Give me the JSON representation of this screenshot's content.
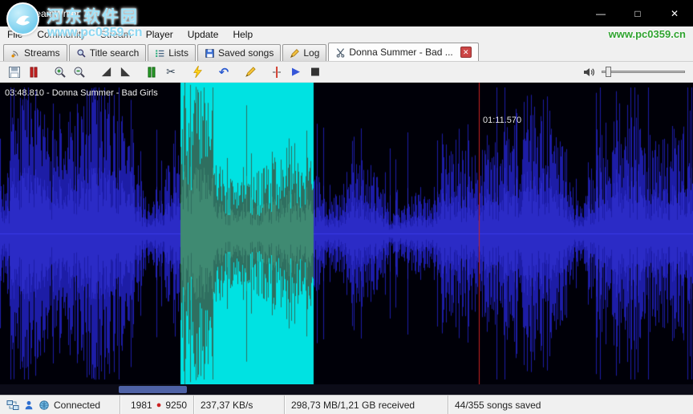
{
  "window": {
    "title": "streamWriter",
    "controls": {
      "minimize": "—",
      "maximize": "□",
      "close": "✕"
    }
  },
  "menu": {
    "items": [
      "File",
      "Community",
      "Stream",
      "Player",
      "Update",
      "Help"
    ]
  },
  "tabs": {
    "items": [
      {
        "label": "Streams"
      },
      {
        "label": "Title search"
      },
      {
        "label": "Lists"
      },
      {
        "label": "Saved songs"
      },
      {
        "label": "Log"
      },
      {
        "label": "Donna Summer - Bad ...",
        "active": true,
        "closable": true
      }
    ],
    "close_glyph": "✕"
  },
  "toolbar": {
    "glyphs": {
      "scissors": "✂",
      "undo": "↶",
      "play": "▶",
      "stop": "■"
    }
  },
  "editor": {
    "overlay_label": "03:48.810 - Donna Summer - Bad Girls",
    "cursor_time": "01:11.570",
    "colors": {
      "background": "#000008",
      "waveform": "#1d1da6",
      "waveform_core": "#2b2bc6",
      "selection": "#00e2e2",
      "selection_wave": "#2f6f60",
      "selection_wave_core": "#3f8a72",
      "center_line": "#3a3ae8",
      "cursor": "#cc2222"
    }
  },
  "statusbar": {
    "connection": "Connected",
    "streams_count": "1981",
    "red_dot": "●",
    "titles_count": "9250",
    "speed": "237,37 KB/s",
    "received": "298,73 MB/1,21 GB received",
    "saved": "44/355 songs saved"
  },
  "watermark": {
    "site_name": "河东软件园",
    "site_url": "www.pc0359.cn",
    "site_url_right": "www.pc0359.cn"
  }
}
